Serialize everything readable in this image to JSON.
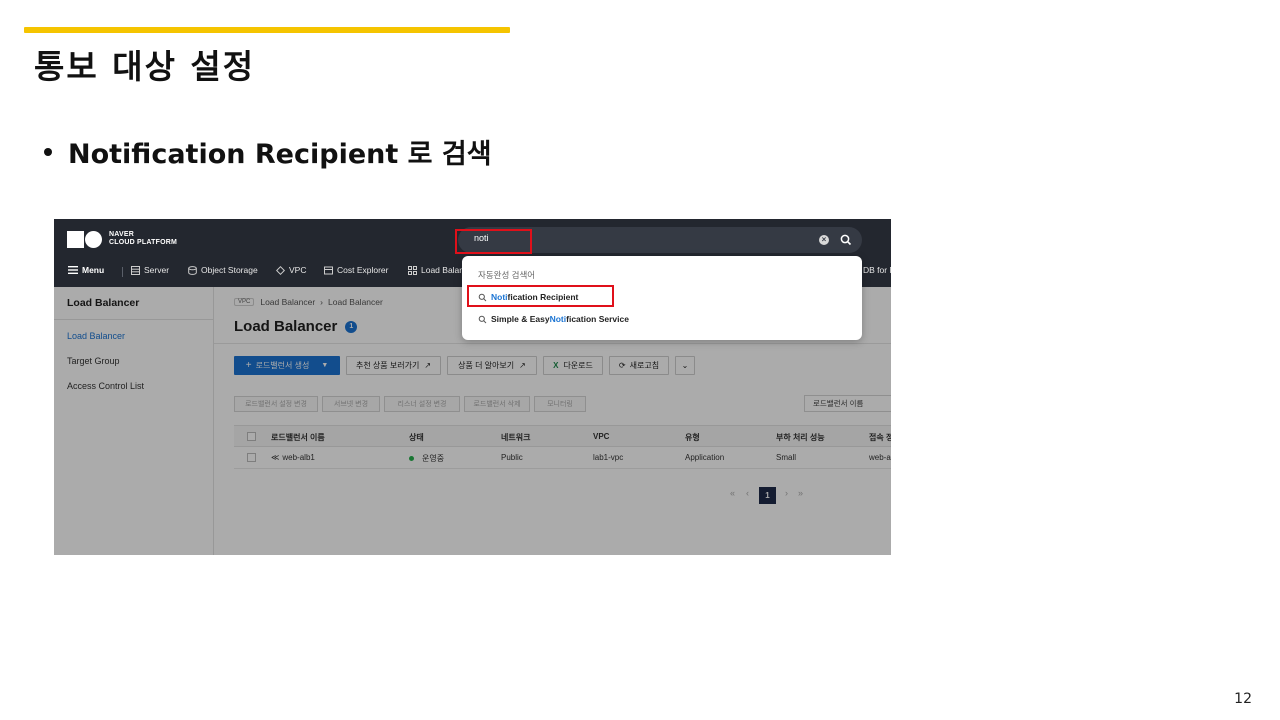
{
  "slide": {
    "title": "통보 대상 설정",
    "bullet": "Notification Recipient 로 검색",
    "page_number": "12"
  },
  "colors": {
    "accent": "#f5c400",
    "highlight": "#e0101a",
    "brand_blue": "#1b74d3",
    "topbar": "#23272f"
  },
  "screenshot": {
    "logo": {
      "line1": "NAVER",
      "line2": "CLOUD PLATFORM"
    },
    "search": {
      "value": "noti"
    },
    "nav": {
      "menu": "Menu",
      "items": [
        {
          "label": "Server",
          "icon": "server-icon"
        },
        {
          "label": "Object Storage",
          "icon": "storage-icon"
        },
        {
          "label": "VPC",
          "icon": "vpc-icon"
        },
        {
          "label": "Cost Explorer",
          "icon": "cost-icon"
        },
        {
          "label": "Load Balan",
          "icon": "load-balancer-icon"
        },
        {
          "label": "DB for M",
          "icon": "db-icon"
        }
      ]
    },
    "sidebar": {
      "title": "Load Balancer",
      "items": [
        "Load Balancer",
        "Target Group",
        "Access Control List"
      ]
    },
    "breadcrumb": {
      "badge": "VPC",
      "part1": "Load Balancer",
      "part2": "Load Balancer"
    },
    "heading": {
      "title": "Load Balancer",
      "count": "1"
    },
    "toolbar": {
      "create": "로드밸런서 생성",
      "recommend": "추천 상품 보러가기",
      "learn_more": "상품 더 알아보기",
      "download": "다운로드",
      "refresh": "새로고침"
    },
    "actions": [
      "로드밸런서 설정 변경",
      "서브넷 변경",
      "리스너 설정 변경",
      "로드밸런서 삭제",
      "모니터링"
    ],
    "filter": {
      "value": "로드밸런서 이름"
    },
    "table": {
      "headers": [
        "로드밸런서 이름",
        "상태",
        "네트워크",
        "VPC",
        "유형",
        "부하 처리 성능",
        "접속 정"
      ],
      "rows": [
        [
          "web-alb1",
          "운영중",
          "Public",
          "lab1-vpc",
          "Application",
          "Small",
          "web-al"
        ]
      ]
    },
    "pagination": {
      "current": "1"
    },
    "autocomplete": {
      "label": "자동완성 검색어",
      "items": [
        {
          "prefix": "",
          "match": "Noti",
          "suffix": "fication Recipient"
        },
        {
          "prefix": "Simple & Easy ",
          "match": "Noti",
          "suffix": "fication Service"
        }
      ]
    }
  }
}
